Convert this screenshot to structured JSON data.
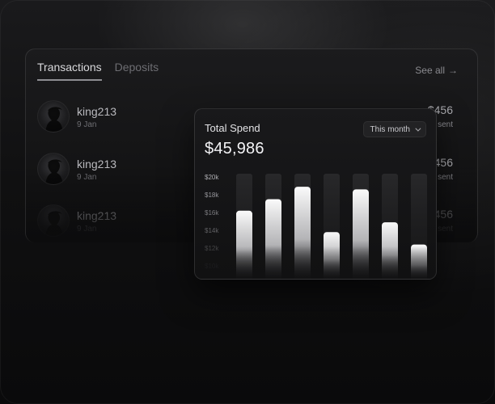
{
  "tabs": [
    {
      "label": "Transactions",
      "active": true
    },
    {
      "label": "Deposits",
      "active": false
    }
  ],
  "see_all": "See all",
  "transactions": [
    {
      "name": "king213",
      "date": "9 Jan",
      "amount": "456",
      "status": "sent"
    },
    {
      "name": "king213",
      "date": "9 Jan",
      "amount": "456",
      "status": "sent"
    },
    {
      "name": "king213",
      "date": "9 Jan",
      "amount": "456",
      "status": "sent"
    }
  ],
  "spend": {
    "title": "Total Spend",
    "value": "$45,986",
    "period": "This month"
  },
  "colors": {
    "status_sent": "#3fbf5f",
    "accent_bar": "#ffffff"
  },
  "chart_data": {
    "type": "bar",
    "title": "",
    "categories": [
      "",
      "",
      "",
      "",
      "",
      "",
      ""
    ],
    "values": [
      16.2,
      17.5,
      18.9,
      13.8,
      18.6,
      14.9,
      12.4
    ],
    "ylim": [
      10,
      20
    ],
    "y_ticks": [
      "$20k",
      "$18k",
      "$16k",
      "$14k",
      "$12k",
      "$10k"
    ],
    "y_tick_values": [
      20,
      18,
      16,
      14,
      12,
      10
    ],
    "grid": false,
    "legend": "none"
  }
}
